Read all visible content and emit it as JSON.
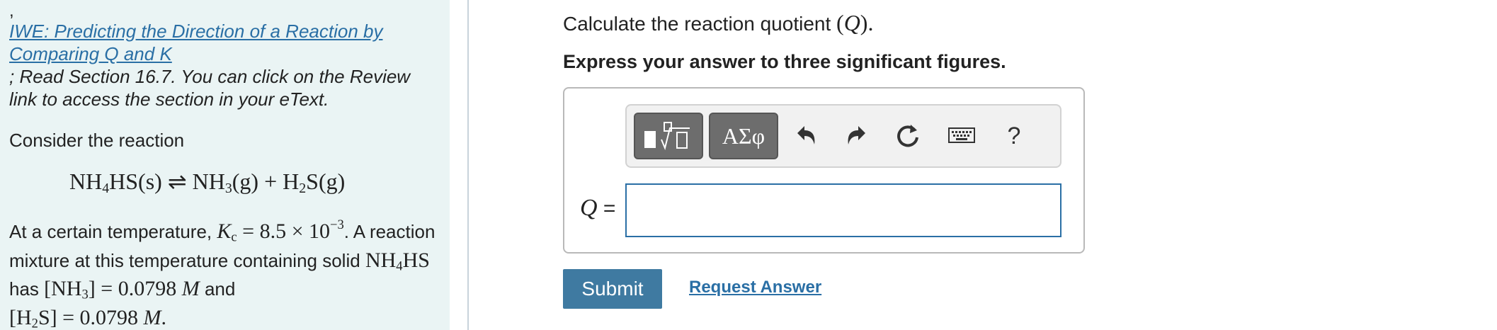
{
  "left_panel": {
    "leading_comma": ",",
    "link_text": "IWE: Predicting the Direction of a Reaction by Comparing Q and K",
    "instruction_text": "; Read Section 16.7. You can click on the Review link to access the section in your eText.",
    "consider_text": "Consider the reaction",
    "reaction": {
      "reactant": "NH4HS(s)",
      "arrow": "⇌",
      "products": "NH3(g) + H2S(g)"
    },
    "temperature_text": {
      "prefix": "At a certain temperature,",
      "kc_label": "Kc",
      "kc_value": "8.5 × 10^-3",
      "suffix": ". A reaction mixture at this temperature containing solid",
      "solid": "NH4HS",
      "has_text": "has",
      "nh3_conc": "[NH3] = 0.0798 M",
      "and_text": "and",
      "h2s_conc": "[H2S] = 0.0798 M."
    }
  },
  "question": {
    "text": "Calculate the reaction quotient",
    "symbol": "(Q).",
    "instruction": "Express your answer to three significant figures."
  },
  "toolbar": {
    "greek_label": "ΑΣφ",
    "help_label": "?"
  },
  "answer": {
    "label": "Q",
    "equals": "=",
    "value": ""
  },
  "actions": {
    "submit_label": "Submit",
    "request_label": "Request Answer"
  },
  "colors": {
    "panel_bg": "#eaf4f4",
    "link": "#2a6fa5",
    "submit_bg": "#3f7aa1"
  }
}
